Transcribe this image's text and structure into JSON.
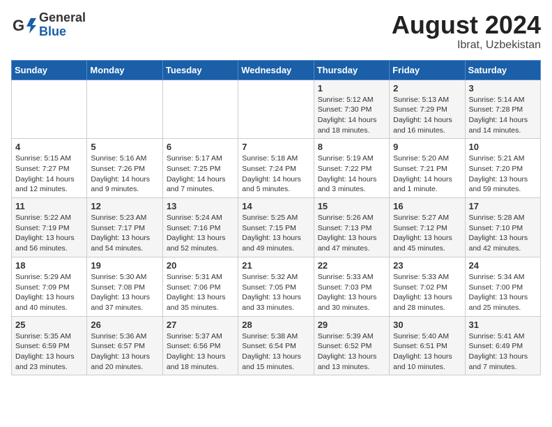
{
  "header": {
    "logo_general": "General",
    "logo_blue": "Blue",
    "month": "August 2024",
    "location": "Ibrat, Uzbekistan"
  },
  "weekdays": [
    "Sunday",
    "Monday",
    "Tuesday",
    "Wednesday",
    "Thursday",
    "Friday",
    "Saturday"
  ],
  "weeks": [
    [
      {
        "day": "",
        "detail": ""
      },
      {
        "day": "",
        "detail": ""
      },
      {
        "day": "",
        "detail": ""
      },
      {
        "day": "",
        "detail": ""
      },
      {
        "day": "1",
        "detail": "Sunrise: 5:12 AM\nSunset: 7:30 PM\nDaylight: 14 hours\nand 18 minutes."
      },
      {
        "day": "2",
        "detail": "Sunrise: 5:13 AM\nSunset: 7:29 PM\nDaylight: 14 hours\nand 16 minutes."
      },
      {
        "day": "3",
        "detail": "Sunrise: 5:14 AM\nSunset: 7:28 PM\nDaylight: 14 hours\nand 14 minutes."
      }
    ],
    [
      {
        "day": "4",
        "detail": "Sunrise: 5:15 AM\nSunset: 7:27 PM\nDaylight: 14 hours\nand 12 minutes."
      },
      {
        "day": "5",
        "detail": "Sunrise: 5:16 AM\nSunset: 7:26 PM\nDaylight: 14 hours\nand 9 minutes."
      },
      {
        "day": "6",
        "detail": "Sunrise: 5:17 AM\nSunset: 7:25 PM\nDaylight: 14 hours\nand 7 minutes."
      },
      {
        "day": "7",
        "detail": "Sunrise: 5:18 AM\nSunset: 7:24 PM\nDaylight: 14 hours\nand 5 minutes."
      },
      {
        "day": "8",
        "detail": "Sunrise: 5:19 AM\nSunset: 7:22 PM\nDaylight: 14 hours\nand 3 minutes."
      },
      {
        "day": "9",
        "detail": "Sunrise: 5:20 AM\nSunset: 7:21 PM\nDaylight: 14 hours\nand 1 minute."
      },
      {
        "day": "10",
        "detail": "Sunrise: 5:21 AM\nSunset: 7:20 PM\nDaylight: 13 hours\nand 59 minutes."
      }
    ],
    [
      {
        "day": "11",
        "detail": "Sunrise: 5:22 AM\nSunset: 7:19 PM\nDaylight: 13 hours\nand 56 minutes."
      },
      {
        "day": "12",
        "detail": "Sunrise: 5:23 AM\nSunset: 7:17 PM\nDaylight: 13 hours\nand 54 minutes."
      },
      {
        "day": "13",
        "detail": "Sunrise: 5:24 AM\nSunset: 7:16 PM\nDaylight: 13 hours\nand 52 minutes."
      },
      {
        "day": "14",
        "detail": "Sunrise: 5:25 AM\nSunset: 7:15 PM\nDaylight: 13 hours\nand 49 minutes."
      },
      {
        "day": "15",
        "detail": "Sunrise: 5:26 AM\nSunset: 7:13 PM\nDaylight: 13 hours\nand 47 minutes."
      },
      {
        "day": "16",
        "detail": "Sunrise: 5:27 AM\nSunset: 7:12 PM\nDaylight: 13 hours\nand 45 minutes."
      },
      {
        "day": "17",
        "detail": "Sunrise: 5:28 AM\nSunset: 7:10 PM\nDaylight: 13 hours\nand 42 minutes."
      }
    ],
    [
      {
        "day": "18",
        "detail": "Sunrise: 5:29 AM\nSunset: 7:09 PM\nDaylight: 13 hours\nand 40 minutes."
      },
      {
        "day": "19",
        "detail": "Sunrise: 5:30 AM\nSunset: 7:08 PM\nDaylight: 13 hours\nand 37 minutes."
      },
      {
        "day": "20",
        "detail": "Sunrise: 5:31 AM\nSunset: 7:06 PM\nDaylight: 13 hours\nand 35 minutes."
      },
      {
        "day": "21",
        "detail": "Sunrise: 5:32 AM\nSunset: 7:05 PM\nDaylight: 13 hours\nand 33 minutes."
      },
      {
        "day": "22",
        "detail": "Sunrise: 5:33 AM\nSunset: 7:03 PM\nDaylight: 13 hours\nand 30 minutes."
      },
      {
        "day": "23",
        "detail": "Sunrise: 5:33 AM\nSunset: 7:02 PM\nDaylight: 13 hours\nand 28 minutes."
      },
      {
        "day": "24",
        "detail": "Sunrise: 5:34 AM\nSunset: 7:00 PM\nDaylight: 13 hours\nand 25 minutes."
      }
    ],
    [
      {
        "day": "25",
        "detail": "Sunrise: 5:35 AM\nSunset: 6:59 PM\nDaylight: 13 hours\nand 23 minutes."
      },
      {
        "day": "26",
        "detail": "Sunrise: 5:36 AM\nSunset: 6:57 PM\nDaylight: 13 hours\nand 20 minutes."
      },
      {
        "day": "27",
        "detail": "Sunrise: 5:37 AM\nSunset: 6:56 PM\nDaylight: 13 hours\nand 18 minutes."
      },
      {
        "day": "28",
        "detail": "Sunrise: 5:38 AM\nSunset: 6:54 PM\nDaylight: 13 hours\nand 15 minutes."
      },
      {
        "day": "29",
        "detail": "Sunrise: 5:39 AM\nSunset: 6:52 PM\nDaylight: 13 hours\nand 13 minutes."
      },
      {
        "day": "30",
        "detail": "Sunrise: 5:40 AM\nSunset: 6:51 PM\nDaylight: 13 hours\nand 10 minutes."
      },
      {
        "day": "31",
        "detail": "Sunrise: 5:41 AM\nSunset: 6:49 PM\nDaylight: 13 hours\nand 7 minutes."
      }
    ]
  ]
}
